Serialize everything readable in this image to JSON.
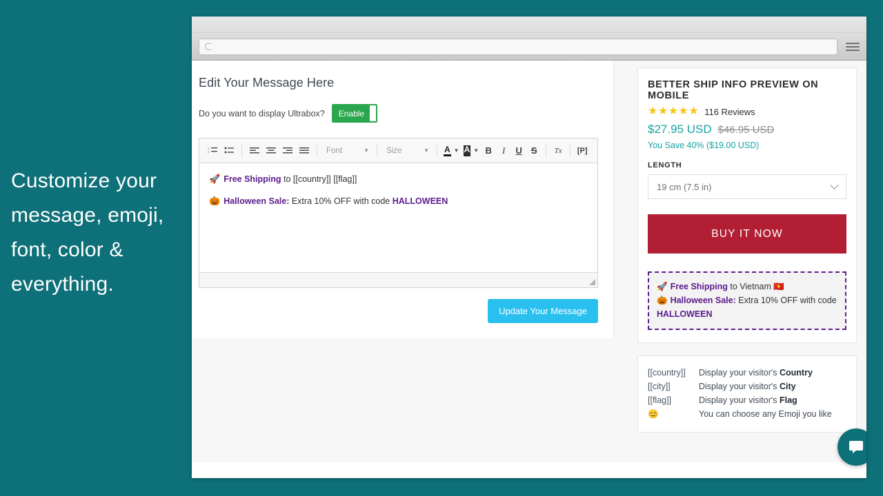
{
  "promo": {
    "caption": "Customize your message, emoji, font, color & everything."
  },
  "browser": {
    "url_value": "",
    "url_placeholder": "",
    "reload_icon": "reload-spinner-icon",
    "menu_icon": "hamburger-menu-icon"
  },
  "editor": {
    "page_title": "Edit Your Message Here",
    "toggle_question": "Do you want to display Ultrabox?",
    "toggle_state_label": "Enable",
    "toolbar": {
      "numbered_list": "1.",
      "bullet_list": "•",
      "align_left": "align-left",
      "align_center": "align-center",
      "align_right": "align-right",
      "align_justify": "align-justify",
      "font_label": "Font",
      "size_label": "Size",
      "text_color": "A",
      "bg_color": "A",
      "bold": "B",
      "italic": "I",
      "underline": "U",
      "strike": "S",
      "remove_format": "Tx",
      "paragraph": "[P]"
    },
    "message_lines": [
      {
        "emoji": "🚀",
        "parts": [
          {
            "text": "Free Shipping",
            "accent": true
          },
          {
            "text": " to [[country]] [[flag]]",
            "accent": false
          }
        ]
      },
      {
        "emoji": "🎃",
        "parts": [
          {
            "text": "Halloween Sale:",
            "accent": true
          },
          {
            "text": " Extra 10% OFF with code ",
            "accent": false
          },
          {
            "text": "HALLOWEEN",
            "accent": true
          }
        ]
      }
    ],
    "update_button": "Update Your Message"
  },
  "product": {
    "title": "BETTER SHIP INFO PREVIEW ON MOBILE",
    "stars": "★★★★★",
    "reviews": "116 Reviews",
    "price_now": "$27.95 USD",
    "price_was": "$46.95 USD",
    "save_line": "You Save 40% ($19.00 USD)",
    "option_label": "LENGTH",
    "option_value": "19 cm (7.5 in)",
    "buy_button": "BUY IT NOW",
    "colors": {
      "price": "#17a2a2",
      "buy_button": "#b21f35",
      "stars": "#f5c518",
      "accent_purple": "#5b1b8c"
    }
  },
  "ship_preview": {
    "line1_emoji": "🚀",
    "line1_bold": "Free Shipping",
    "line1_rest": " to Vietnam ",
    "line1_flag": "🇻🇳",
    "line2_emoji": "🎃",
    "line2_bold": "Halloween Sale:",
    "line2_rest": " Extra 10% OFF with code ",
    "line2_code": "HALLOWEEN"
  },
  "legend": {
    "rows": [
      {
        "key": "[[country]]",
        "prefix": "Display your visitor's ",
        "bold": "Country"
      },
      {
        "key": "[[city]]",
        "prefix": "Display your visitor's ",
        "bold": "City"
      },
      {
        "key": "[[flag]]",
        "prefix": "Display your visitor's ",
        "bold": "Flag"
      },
      {
        "key": "😊",
        "prefix": "You can choose any Emoji you like",
        "bold": ""
      }
    ]
  },
  "chat": {
    "icon": "chat-bubble-icon"
  }
}
